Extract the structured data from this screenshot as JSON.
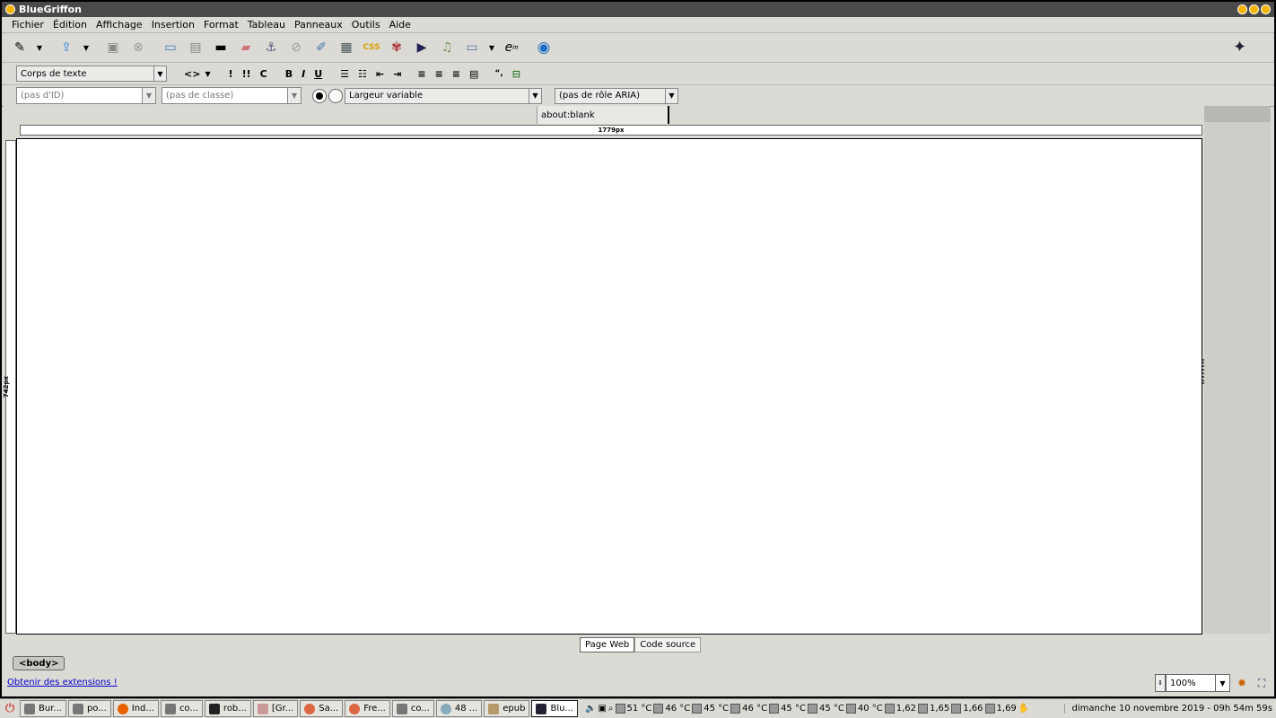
{
  "window": {
    "title": "BlueGriffon"
  },
  "menu": [
    "Fichier",
    "Édition",
    "Affichage",
    "Insertion",
    "Format",
    "Tableau",
    "Panneaux",
    "Outils",
    "Aide"
  ],
  "toolbar2": {
    "paragraph_format": "Corps de texte",
    "code_label": "<>",
    "em1": "!",
    "em2": "!!",
    "cite": "C",
    "bold": "B",
    "italic": "I",
    "underline": "U"
  },
  "toolbar3": {
    "id_placeholder": "(pas d'ID)",
    "class_placeholder": "(pas de classe)",
    "width_mode": "Largeur variable",
    "aria_role": "(pas de rôle ARIA)"
  },
  "tab": {
    "label": "about:blank"
  },
  "rulers": {
    "horizontal": "1779px",
    "vertical": "742px"
  },
  "mode_tabs": {
    "wysiwyg": "Page Web",
    "source": "Code source"
  },
  "status": {
    "breadcrumb": "<body>",
    "extensions_link": "Obtenir des extensions !",
    "zoom": "100%"
  },
  "taskbar": {
    "tasks": [
      "Bur...",
      "po...",
      "Ind...",
      "co...",
      "rob...",
      "[Gr...",
      "Sa...",
      "Fre...",
      "co...",
      "48 ...",
      "epub",
      "Blu..."
    ],
    "sensors": [
      "51 °C",
      "46 °C",
      "45 °C",
      "46 °C",
      "45 °C",
      "45 °C",
      "40 °C",
      "1,62",
      "1,65",
      "1,66",
      "1,69"
    ],
    "clock": "dimanche 10 novembre 2019 - 09h 54m 59s"
  }
}
